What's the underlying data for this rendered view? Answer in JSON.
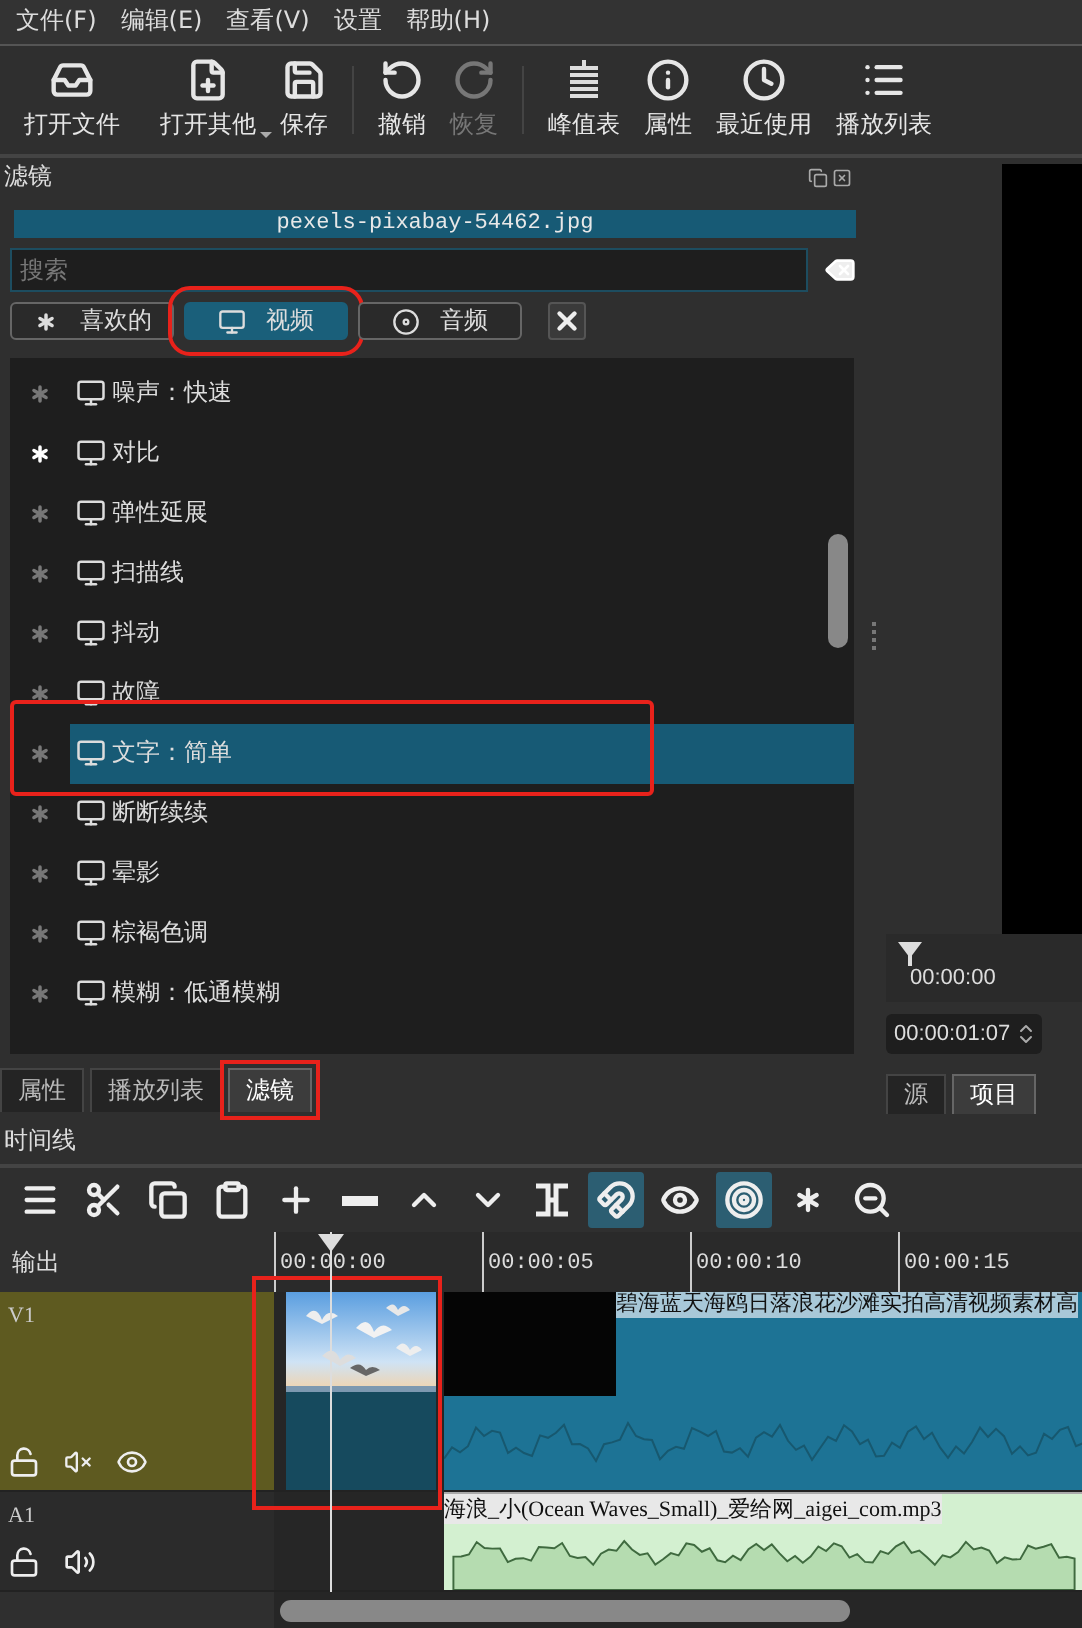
{
  "menu": [
    "文件(F)",
    "编辑(E)",
    "查看(V)",
    "设置",
    "帮助(H)"
  ],
  "toolbar": {
    "groups": [
      [
        {
          "label": "打开文件",
          "dropdown": false,
          "disabled": false
        },
        {
          "label": "打开其他",
          "dropdown": true,
          "disabled": false
        },
        {
          "label": "保存",
          "dropdown": false,
          "disabled": false
        }
      ],
      [
        {
          "label": "撤销",
          "dropdown": false,
          "disabled": false
        },
        {
          "label": "恢复",
          "dropdown": false,
          "disabled": true
        }
      ],
      [
        {
          "label": "峰值表",
          "dropdown": false,
          "disabled": false
        },
        {
          "label": "属性",
          "dropdown": false,
          "disabled": false
        },
        {
          "label": "最近使用",
          "dropdown": false,
          "disabled": false
        },
        {
          "label": "播放列表",
          "dropdown": false,
          "disabled": false
        }
      ]
    ]
  },
  "filters_panel": {
    "title": "滤镜",
    "clip_name": "pexels-pixabay-54462.jpg",
    "search": {
      "placeholder": "搜索"
    },
    "categories": [
      {
        "label": "喜欢的",
        "selected": false,
        "annotated": false
      },
      {
        "label": "视频",
        "selected": true,
        "annotated": true
      },
      {
        "label": "音频",
        "selected": false,
        "annotated": false
      }
    ],
    "items": [
      {
        "label": "噪声：快速",
        "favorite": false,
        "selected": false,
        "annotated": false
      },
      {
        "label": "对比",
        "favorite": true,
        "selected": false,
        "annotated": false
      },
      {
        "label": "弹性延展",
        "favorite": false,
        "selected": false,
        "annotated": false
      },
      {
        "label": "扫描线",
        "favorite": false,
        "selected": false,
        "annotated": false
      },
      {
        "label": "抖动",
        "favorite": false,
        "selected": false,
        "annotated": false
      },
      {
        "label": "故障",
        "favorite": false,
        "selected": false,
        "annotated": false
      },
      {
        "label": "文字：简单",
        "favorite": false,
        "selected": true,
        "annotated": true
      },
      {
        "label": "断断续续",
        "favorite": false,
        "selected": false,
        "annotated": false
      },
      {
        "label": "晕影",
        "favorite": false,
        "selected": false,
        "annotated": false
      },
      {
        "label": "棕褐色调",
        "favorite": false,
        "selected": false,
        "annotated": false
      },
      {
        "label": "模糊：低通模糊",
        "favorite": false,
        "selected": false,
        "annotated": false
      }
    ]
  },
  "left_tabs": [
    {
      "label": "属性",
      "selected": false,
      "annotated": false
    },
    {
      "label": "播放列表",
      "selected": false,
      "annotated": false
    },
    {
      "label": "滤镜",
      "selected": true,
      "annotated": true
    }
  ],
  "preview": {
    "ruler_time": "00:00:00",
    "timecode": "00:00:01:07"
  },
  "right_tabs": [
    {
      "label": "源",
      "selected": false
    },
    {
      "label": "项目",
      "selected": true
    }
  ],
  "timeline": {
    "title": "时间线",
    "tools": [
      {
        "on": false
      },
      {
        "on": false
      },
      {
        "on": false
      },
      {
        "on": false
      },
      {
        "on": false
      },
      {
        "on": false
      },
      {
        "on": false
      },
      {
        "on": false
      },
      {
        "on": false
      },
      {
        "on": true
      },
      {
        "on": false
      },
      {
        "on": true
      },
      {
        "on": false
      },
      {
        "on": false
      }
    ],
    "output_label": "输出",
    "ruler": [
      "00:00:00",
      "00:00:05",
      "00:00:10",
      "00:00:15"
    ],
    "tracks": [
      {
        "name": "V1",
        "kind": "video",
        "selected": true,
        "clips": [
          {
            "kind": "picture",
            "annotated": true
          },
          {
            "kind": "video",
            "title": "碧海蓝天海鸥日落浪花沙滩实拍高清视频素材高"
          }
        ]
      },
      {
        "name": "A1",
        "kind": "audio",
        "selected": false,
        "clips": [
          {
            "kind": "audio",
            "title": "海浪_小(Ocean Waves_Small)_爱给网_aigei_com.mp3"
          }
        ]
      }
    ]
  }
}
